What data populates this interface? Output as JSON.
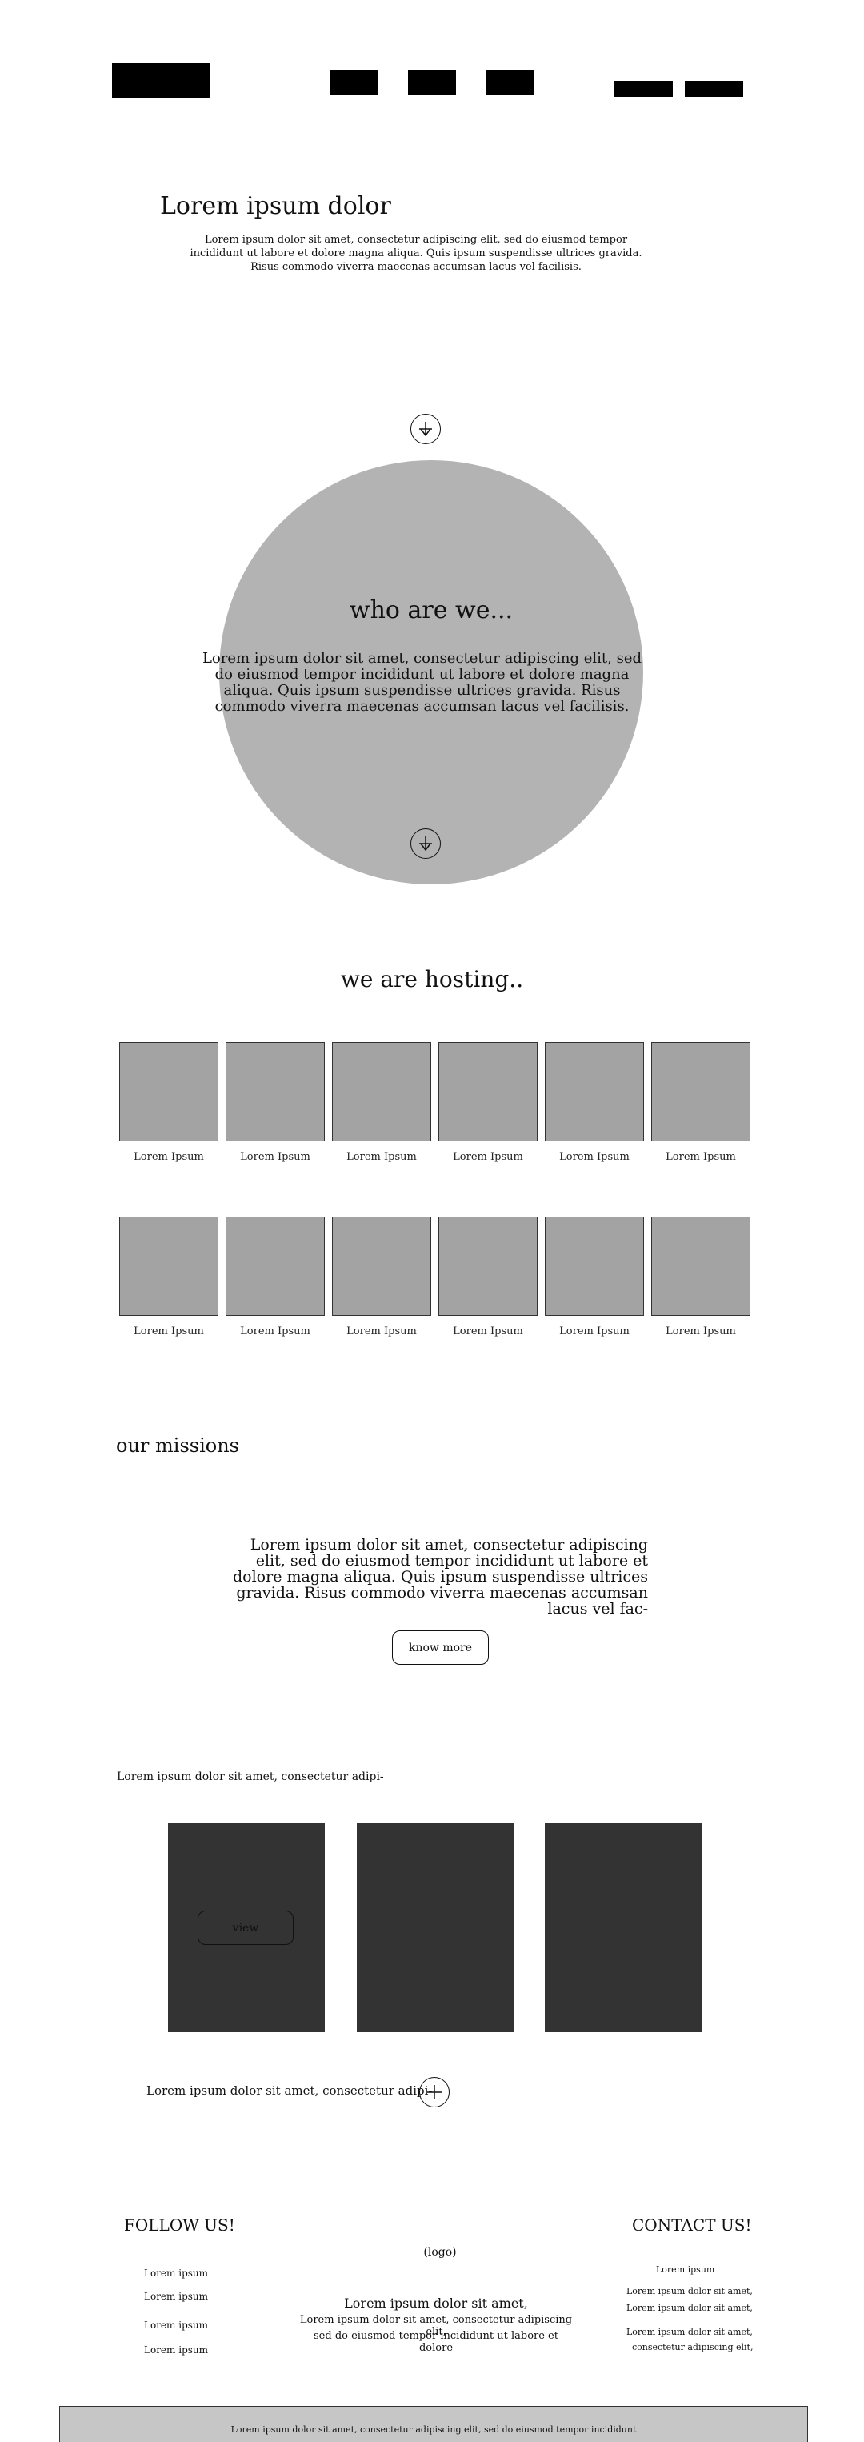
{
  "hero": {
    "title": "Lorem ipsum dolor",
    "text": "Lorem ipsum dolor sit amet, consectetur adipiscing elit, sed do eiusmod tempor incididunt ut labore et dolore magna aliqua. Quis ipsum suspendisse ultrices gravida. Risus commodo viverra maecenas accumsan lacus vel facilisis."
  },
  "who": {
    "title": "who are we...",
    "text": "Lorem ipsum dolor sit amet, consectetur adipiscing elit, sed do eiusmod tempor incididunt ut labore et dolore magna aliqua. Quis ipsum suspendisse ultrices gravida. Risus commodo viverra maecenas accumsan lacus vel facilisis."
  },
  "hosting": {
    "title": "we are hosting..",
    "items": [
      "Lorem Ipsum",
      "Lorem Ipsum",
      "Lorem Ipsum",
      "Lorem Ipsum",
      "Lorem Ipsum",
      "Lorem Ipsum",
      "Lorem Ipsum",
      "Lorem Ipsum",
      "Lorem Ipsum",
      "Lorem Ipsum",
      "Lorem Ipsum",
      "Lorem Ipsum"
    ]
  },
  "missions": {
    "title": "our missions",
    "text": "Lorem ipsum dolor sit amet, consectetur adipiscing elit, sed do eiusmod tempor incididunt ut labore et dolore magna aliqua. Quis ipsum suspendisse ultrices gravida. Risus commodo viverra maecenas accumsan lacus vel fac-",
    "button": "know more"
  },
  "gallery": {
    "intro": "Lorem ipsum dolor sit amet, consectetur adipi-",
    "view_button": "view",
    "more_text": "Lorem ipsum dolor sit amet, consectetur adipi-"
  },
  "footer": {
    "follow_title": "FOLLOW US!",
    "follow_items": [
      "Lorem ipsum",
      "Lorem ipsum",
      "Lorem ipsum",
      "Lorem ipsum"
    ],
    "logo": "logo",
    "center_title": "Lorem ipsum dolor sit amet,",
    "center_line1": "Lorem ipsum dolor sit amet, consectetur adipiscing elit,",
    "center_line2": "sed do eiusmod tempor incididunt ut labore et dolore",
    "contact_title": "CONTACT US!",
    "contact_items": [
      "Lorem ipsum",
      "Lorem ipsum dolor sit amet,",
      "Lorem ipsum dolor sit amet,",
      "Lorem ipsum dolor sit amet,",
      "consectetur adipiscing elit,"
    ],
    "bottom_bar": "Lorem ipsum dolor sit amet, consectetur adipiscing elit, sed do eiusmod tempor incididunt"
  },
  "colors": {
    "circle": "#b3b3b3",
    "thumbnail": "#a3a3a3",
    "card": "#333333",
    "bottom_bar": "#c6c6c6"
  }
}
